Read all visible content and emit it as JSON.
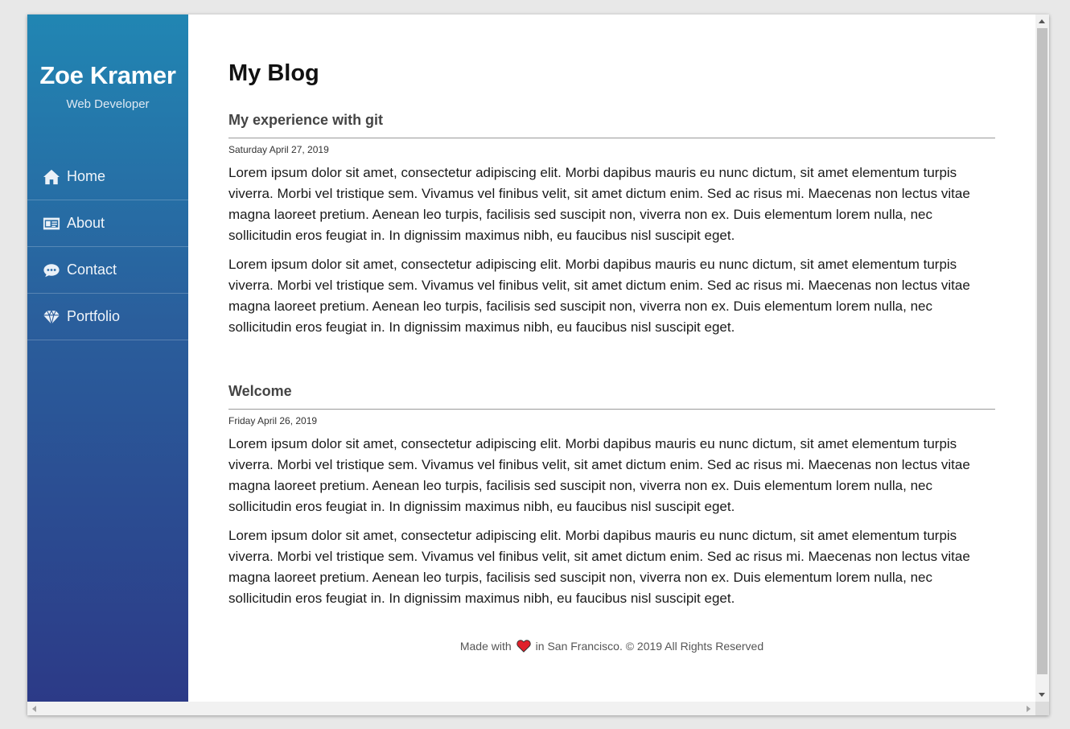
{
  "sidebar": {
    "name": "Zoe Kramer",
    "role": "Web Developer",
    "items": [
      {
        "label": "Home",
        "icon": "home-icon"
      },
      {
        "label": "About",
        "icon": "id-card-icon"
      },
      {
        "label": "Contact",
        "icon": "chat-bubble-icon"
      },
      {
        "label": "Portfolio",
        "icon": "diamond-icon"
      }
    ],
    "gradient_top": "#2186b3",
    "gradient_bottom": "#2c3a87"
  },
  "main": {
    "title": "My Blog",
    "posts": [
      {
        "title": "My experience with git",
        "date": "Saturday April 27, 2019",
        "paragraphs": [
          "Lorem ipsum dolor sit amet, consectetur adipiscing elit. Morbi dapibus mauris eu nunc dictum, sit amet elementum turpis viverra. Morbi vel tristique sem. Vivamus vel finibus velit, sit amet dictum enim. Sed ac risus mi. Maecenas non lectus vitae magna laoreet pretium. Aenean leo turpis, facilisis sed suscipit non, viverra non ex. Duis elementum lorem nulla, nec sollicitudin eros feugiat in. In dignissim maximus nibh, eu faucibus nisl suscipit eget.",
          "Lorem ipsum dolor sit amet, consectetur adipiscing elit. Morbi dapibus mauris eu nunc dictum, sit amet elementum turpis viverra. Morbi vel tristique sem. Vivamus vel finibus velit, sit amet dictum enim. Sed ac risus mi. Maecenas non lectus vitae magna laoreet pretium. Aenean leo turpis, facilisis sed suscipit non, viverra non ex. Duis elementum lorem nulla, nec sollicitudin eros feugiat in. In dignissim maximus nibh, eu faucibus nisl suscipit eget."
        ]
      },
      {
        "title": "Welcome",
        "date": "Friday April 26, 2019",
        "paragraphs": [
          "Lorem ipsum dolor sit amet, consectetur adipiscing elit. Morbi dapibus mauris eu nunc dictum, sit amet elementum turpis viverra. Morbi vel tristique sem. Vivamus vel finibus velit, sit amet dictum enim. Sed ac risus mi. Maecenas non lectus vitae magna laoreet pretium. Aenean leo turpis, facilisis sed suscipit non, viverra non ex. Duis elementum lorem nulla, nec sollicitudin eros feugiat in. In dignissim maximus nibh, eu faucibus nisl suscipit eget.",
          "Lorem ipsum dolor sit amet, consectetur adipiscing elit. Morbi dapibus mauris eu nunc dictum, sit amet elementum turpis viverra. Morbi vel tristique sem. Vivamus vel finibus velit, sit amet dictum enim. Sed ac risus mi. Maecenas non lectus vitae magna laoreet pretium. Aenean leo turpis, facilisis sed suscipit non, viverra non ex. Duis elementum lorem nulla, nec sollicitudin eros feugiat in. In dignissim maximus nibh, eu faucibus nisl suscipit eget."
        ]
      }
    ]
  },
  "footer": {
    "before": "Made with",
    "icon": "heart-icon",
    "after": "in San Francisco. © 2019 All Rights Reserved",
    "heart_color": "#e0202b"
  }
}
